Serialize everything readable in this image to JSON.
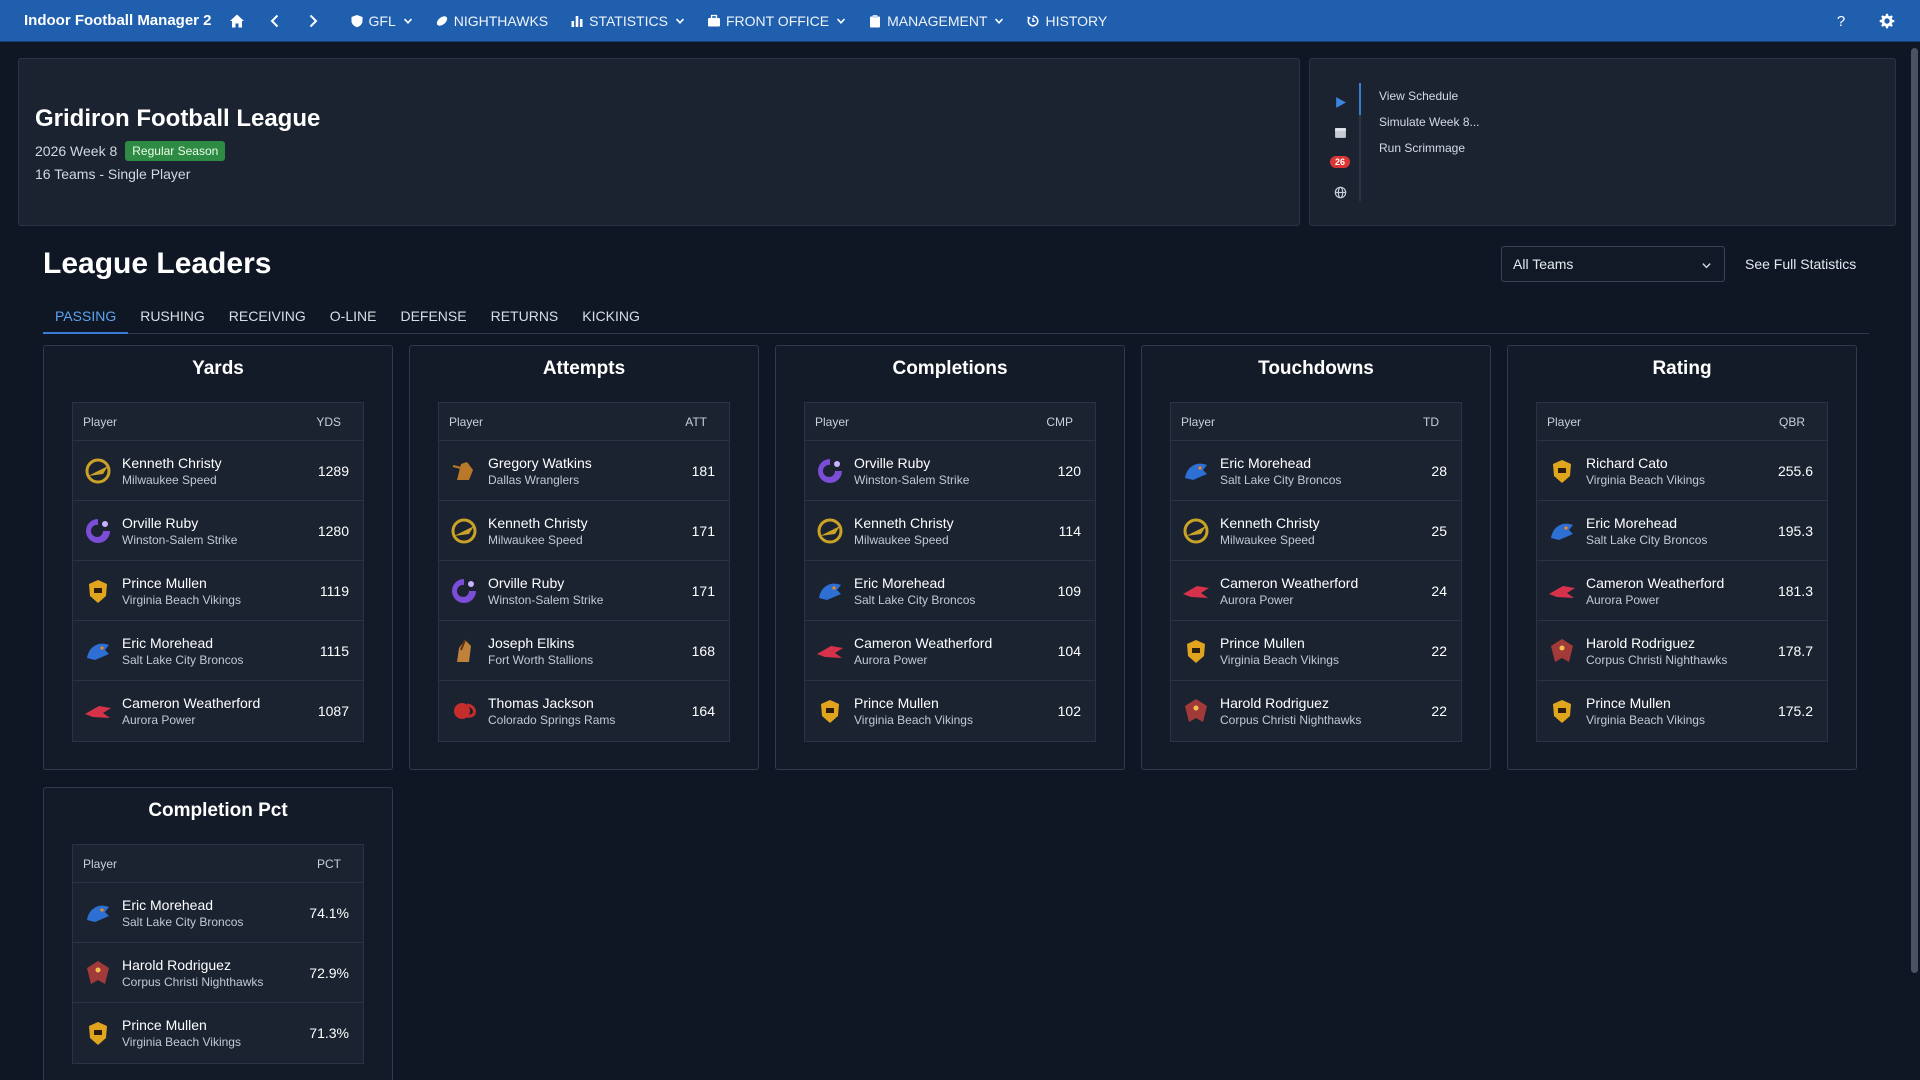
{
  "app": {
    "title": "Indoor Football Manager 2",
    "nav": [
      {
        "label": "GFL",
        "icon": "shield-icon",
        "dropdown": true
      },
      {
        "label": "NIGHTHAWKS",
        "icon": "football-icon",
        "dropdown": false
      },
      {
        "label": "STATISTICS",
        "icon": "bar-chart-icon",
        "dropdown": true
      },
      {
        "label": "FRONT OFFICE",
        "icon": "briefcase-icon",
        "dropdown": true
      },
      {
        "label": "MANAGEMENT",
        "icon": "clipboard-icon",
        "dropdown": true
      },
      {
        "label": "HISTORY",
        "icon": "history-icon",
        "dropdown": false
      }
    ],
    "help_icon": "?"
  },
  "league": {
    "name": "Gridiron Football League",
    "week": "2026 Week 8",
    "phase_badge": "Regular Season",
    "teams_info": "16 Teams - Single Player"
  },
  "actions": {
    "notification_count": "26",
    "links": [
      "View Schedule",
      "Simulate Week 8...",
      "Run Scrimmage"
    ]
  },
  "leaders": {
    "title": "League Leaders",
    "team_filter": "All Teams",
    "full_stats_link": "See Full Statistics",
    "tabs": [
      "PASSING",
      "RUSHING",
      "RECEIVING",
      "O-LINE",
      "DEFENSE",
      "RETURNS",
      "KICKING"
    ],
    "active_tab": "PASSING",
    "player_col": "Player",
    "cards": [
      {
        "title": "Yards",
        "stat_col": "YDS",
        "rows": [
          {
            "name": "Kenneth Christy",
            "team": "Milwaukee Speed",
            "value": "1289",
            "logo": "speed"
          },
          {
            "name": "Orville Ruby",
            "team": "Winston-Salem Strike",
            "value": "1280",
            "logo": "strike"
          },
          {
            "name": "Prince Mullen",
            "team": "Virginia Beach Vikings",
            "value": "1119",
            "logo": "vikings"
          },
          {
            "name": "Eric Morehead",
            "team": "Salt Lake City Broncos",
            "value": "1115",
            "logo": "broncos"
          },
          {
            "name": "Cameron Weatherford",
            "team": "Aurora Power",
            "value": "1087",
            "logo": "power"
          }
        ]
      },
      {
        "title": "Attempts",
        "stat_col": "ATT",
        "rows": [
          {
            "name": "Gregory Watkins",
            "team": "Dallas Wranglers",
            "value": "181",
            "logo": "wranglers"
          },
          {
            "name": "Kenneth Christy",
            "team": "Milwaukee Speed",
            "value": "171",
            "logo": "speed"
          },
          {
            "name": "Orville Ruby",
            "team": "Winston-Salem Strike",
            "value": "171",
            "logo": "strike"
          },
          {
            "name": "Joseph Elkins",
            "team": "Fort Worth Stallions",
            "value": "168",
            "logo": "stallions"
          },
          {
            "name": "Thomas Jackson",
            "team": "Colorado Springs Rams",
            "value": "164",
            "logo": "rams"
          }
        ]
      },
      {
        "title": "Completions",
        "stat_col": "CMP",
        "rows": [
          {
            "name": "Orville Ruby",
            "team": "Winston-Salem Strike",
            "value": "120",
            "logo": "strike"
          },
          {
            "name": "Kenneth Christy",
            "team": "Milwaukee Speed",
            "value": "114",
            "logo": "speed"
          },
          {
            "name": "Eric Morehead",
            "team": "Salt Lake City Broncos",
            "value": "109",
            "logo": "broncos"
          },
          {
            "name": "Cameron Weatherford",
            "team": "Aurora Power",
            "value": "104",
            "logo": "power"
          },
          {
            "name": "Prince Mullen",
            "team": "Virginia Beach Vikings",
            "value": "102",
            "logo": "vikings"
          }
        ]
      },
      {
        "title": "Touchdowns",
        "stat_col": "TD",
        "rows": [
          {
            "name": "Eric Morehead",
            "team": "Salt Lake City Broncos",
            "value": "28",
            "logo": "broncos"
          },
          {
            "name": "Kenneth Christy",
            "team": "Milwaukee Speed",
            "value": "25",
            "logo": "speed"
          },
          {
            "name": "Cameron Weatherford",
            "team": "Aurora Power",
            "value": "24",
            "logo": "power"
          },
          {
            "name": "Prince Mullen",
            "team": "Virginia Beach Vikings",
            "value": "22",
            "logo": "vikings"
          },
          {
            "name": "Harold Rodriguez",
            "team": "Corpus Christi Nighthawks",
            "value": "22",
            "logo": "nighthawks"
          }
        ]
      },
      {
        "title": "Rating",
        "stat_col": "QBR",
        "rows": [
          {
            "name": "Richard Cato",
            "team": "Virginia Beach Vikings",
            "value": "255.6",
            "logo": "vikings"
          },
          {
            "name": "Eric Morehead",
            "team": "Salt Lake City Broncos",
            "value": "195.3",
            "logo": "broncos"
          },
          {
            "name": "Cameron Weatherford",
            "team": "Aurora Power",
            "value": "181.3",
            "logo": "power"
          },
          {
            "name": "Harold Rodriguez",
            "team": "Corpus Christi Nighthawks",
            "value": "178.7",
            "logo": "nighthawks"
          },
          {
            "name": "Prince Mullen",
            "team": "Virginia Beach Vikings",
            "value": "175.2",
            "logo": "vikings"
          }
        ]
      },
      {
        "title": "Completion Pct",
        "stat_col": "PCT",
        "rows": [
          {
            "name": "Eric Morehead",
            "team": "Salt Lake City Broncos",
            "value": "74.1%",
            "logo": "broncos"
          },
          {
            "name": "Harold Rodriguez",
            "team": "Corpus Christi Nighthawks",
            "value": "72.9%",
            "logo": "nighthawks"
          },
          {
            "name": "Prince Mullen",
            "team": "Virginia Beach Vikings",
            "value": "71.3%",
            "logo": "vikings"
          }
        ]
      }
    ]
  },
  "logo_colors": {
    "speed": "#c9a227",
    "strike": "#7c4dd6",
    "vikings": "#e0a41f",
    "broncos": "#2d6fd2",
    "power": "#d6334a",
    "wranglers": "#b9782a",
    "stallions": "#c0813a",
    "rams": "#c62d2d",
    "nighthawks": "#a33a3a"
  }
}
